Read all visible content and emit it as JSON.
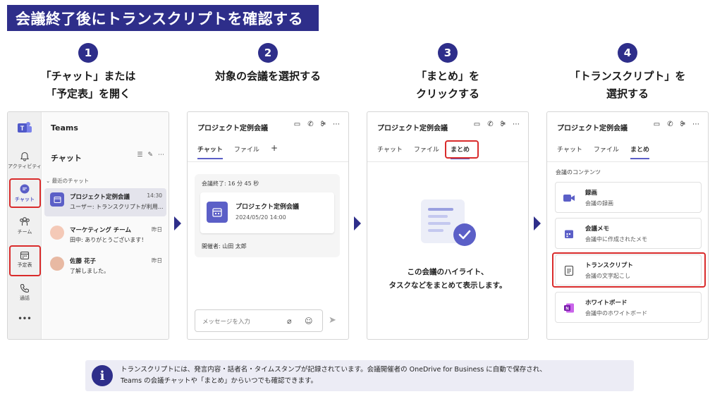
{
  "title": "会議終了後にトランスクリプトを確認する",
  "steps": [
    {
      "num": "1",
      "caption_1": "「チャット」または",
      "caption_2": "「予定表」を開く"
    },
    {
      "num": "2",
      "caption_1": "対象の会議を選択する",
      "caption_2": ""
    },
    {
      "num": "3",
      "caption_1": "「まとめ」を",
      "caption_2": "クリックする"
    },
    {
      "num": "4",
      "caption_1": "「トランスクリプト」を",
      "caption_2": "選択する"
    }
  ],
  "panel1": {
    "app_name": "Teams",
    "rail": [
      {
        "label": "アクティビティ",
        "icon": "bell-icon"
      },
      {
        "label": "チャット",
        "icon": "chat-icon"
      },
      {
        "label": "チーム",
        "icon": "teams-icon"
      },
      {
        "label": "予定表",
        "icon": "calendar-icon"
      },
      {
        "label": "通話",
        "icon": "phone-icon"
      },
      {
        "label": "•••",
        "icon": "more-icon"
      }
    ],
    "chat_heading": "チャット",
    "recent_label": "⌄ 最近のチャット",
    "chats": [
      {
        "name": "プロジェクト定例会議",
        "time": "14:30",
        "preview": "ユーザー: トランスクリプトが利用..."
      },
      {
        "name": "マーケティング チーム",
        "time": "昨日",
        "preview": "田中: ありがとうございます！"
      },
      {
        "name": "佐藤 花子",
        "time": "昨日",
        "preview": "了解しました。"
      }
    ]
  },
  "panel2": {
    "title": "プロジェクト定例会議",
    "tabs": [
      "チャット",
      "ファイル",
      "+"
    ],
    "ended": "会議終了: 16 分 45 秒",
    "meeting_name": "プロジェクト定例会議",
    "meeting_date": "2024/05/20 14:00",
    "organizer": "開催者: 山田 太郎",
    "message_placeholder": "メッセージを入力"
  },
  "panel3": {
    "title": "プロジェクト定例会議",
    "tabs": [
      "チャット",
      "ファイル",
      "まとめ"
    ],
    "text_1": "この会議のハイライト、",
    "text_2": "タスクなどをまとめて表示します。"
  },
  "panel4": {
    "title": "プロジェクト定例会議",
    "tabs": [
      "チャット",
      "ファイル",
      "まとめ"
    ],
    "section": "会議のコンテンツ",
    "items": [
      {
        "title": "録画",
        "sub": "会議の録画",
        "icon": "video-icon"
      },
      {
        "title": "会議メモ",
        "sub": "会議中に作成されたメモ",
        "icon": "notes-icon"
      },
      {
        "title": "トランスクリプト",
        "sub": "会議の文字起こし",
        "icon": "transcript-icon"
      },
      {
        "title": "ホワイトボード",
        "sub": "会議中のホワイトボード",
        "icon": "whiteboard-icon"
      }
    ]
  },
  "info": {
    "line_1": "トランスクリプトには、発言内容・話者名・タイムスタンプが記録されています。会議開催者の OneDrive for Business に自動で保存され、",
    "line_2": "Teams の会議チャットや「まとめ」からいつでも確認できます。"
  },
  "colors": {
    "accent": "#2e2e8a",
    "teams_purple": "#5b5fc7",
    "highlight": "#d92b2b"
  }
}
